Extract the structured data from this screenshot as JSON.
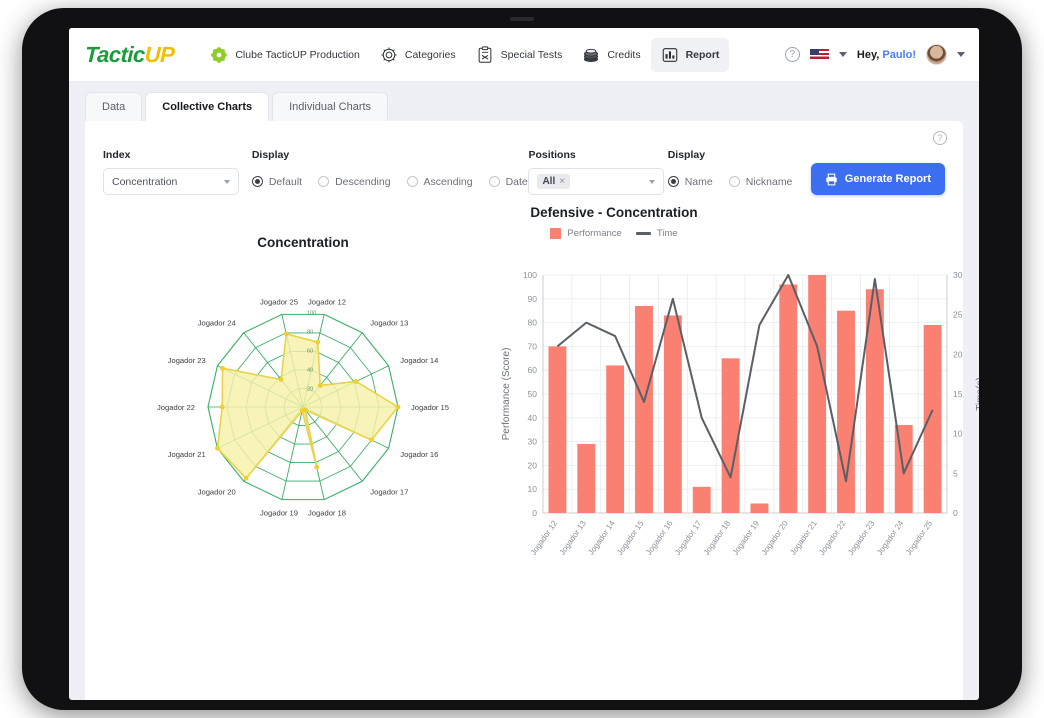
{
  "navbar": {
    "logo_tactic": "Tactic",
    "logo_up": "UP",
    "items": [
      {
        "label": "Clube TacticUP Production",
        "icon": "cluster-icon",
        "active": false
      },
      {
        "label": "Categories",
        "icon": "gear-icon",
        "active": false
      },
      {
        "label": "Special Tests",
        "icon": "clipboard-icon",
        "active": false
      },
      {
        "label": "Credits",
        "icon": "coins-icon",
        "active": false
      },
      {
        "label": "Report",
        "icon": "bar-chart-icon",
        "active": true
      }
    ],
    "help_icon": "?",
    "language_flag": "us-flag-icon",
    "greeting_prefix": "Hey, ",
    "greeting_user": "Paulo!",
    "avatar": "user-avatar"
  },
  "tabs": [
    {
      "label": "Data",
      "active": false
    },
    {
      "label": "Collective Charts",
      "active": true
    },
    {
      "label": "Individual Charts",
      "active": false
    }
  ],
  "card_help_icon": "?",
  "filters": {
    "index": {
      "label": "Index",
      "value": "Concentration"
    },
    "display_order": {
      "label": "Display",
      "options": [
        "Default",
        "Descending",
        "Ascending",
        "Date"
      ],
      "selected": "Default"
    },
    "positions": {
      "label": "Positions",
      "chip": "All",
      "chip_remove": "×"
    },
    "display_name": {
      "label": "Display",
      "options": [
        "Name",
        "Nickname"
      ],
      "selected": "Name"
    },
    "generate_button": {
      "label": "Generate Report",
      "icon": "printer-icon"
    }
  },
  "chart_data": [
    {
      "type": "radar",
      "title": "Concentration",
      "categories": [
        "Jogador 12",
        "Jogador 13",
        "Jogador 14",
        "Jogador 15",
        "Jogador 16",
        "Jogador 17",
        "Jogador 18",
        "Jogador 19",
        "Jogador 20",
        "Jogador 21",
        "Jogador 22",
        "Jogador 23",
        "Jogador 24",
        "Jogador 25"
      ],
      "values": [
        70,
        29,
        62,
        100,
        80,
        4,
        65,
        4,
        96,
        100,
        85,
        94,
        37,
        79
      ],
      "rlim": [
        0,
        100
      ],
      "rticks": [
        20,
        40,
        60,
        80,
        100
      ],
      "grid": true,
      "fill_color": "#f7f0a8",
      "line_color": "#e8d34a",
      "grid_color": "#2faa5d",
      "legend": "none"
    },
    {
      "type": "bar",
      "title": "Defensive - Concentration",
      "categories": [
        "Jogador 12",
        "Jogador 13",
        "Jogador 14",
        "Jogador 15",
        "Jogador 16",
        "Jogador 17",
        "Jogador 18",
        "Jogador 19",
        "Jogador 20",
        "Jogador 21",
        "Jogador 22",
        "Jogador 23",
        "Jogador 24",
        "Jogador 25"
      ],
      "series": [
        {
          "name": "Performance",
          "type": "bar",
          "axis": "left",
          "color": "#fa8072",
          "values": [
            70,
            29,
            62,
            87,
            83,
            11,
            65,
            4,
            96,
            100,
            85,
            94,
            37,
            79
          ]
        },
        {
          "name": "Time",
          "type": "line",
          "axis": "right",
          "color": "#5a5f66",
          "values": [
            21,
            24,
            22.3,
            14,
            27,
            12,
            4.5,
            23.7,
            30,
            21,
            4,
            29.5,
            5,
            13
          ]
        }
      ],
      "ylabel": "Performance (Score)",
      "ylim": [
        0,
        100
      ],
      "yticks": [
        0,
        10,
        20,
        30,
        40,
        50,
        60,
        70,
        80,
        90,
        100
      ],
      "y2label": "Time(s)",
      "y2lim": [
        0,
        30
      ],
      "y2ticks": [
        0,
        5,
        10,
        15,
        20,
        25,
        30
      ],
      "xlabel": "",
      "grid": true,
      "legend_position": "top"
    }
  ]
}
